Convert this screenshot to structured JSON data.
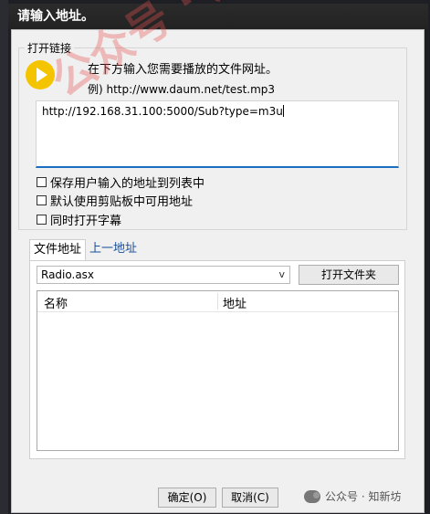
{
  "window": {
    "title": "请输入地址。"
  },
  "open_link": {
    "legend": "打开链接",
    "instruction": "在下方输入您需要播放的文件网址。",
    "example": "例) http://www.daum.net/test.mp3",
    "url_value": "http://192.168.31.100:5000/Sub?type=m3u"
  },
  "options": [
    {
      "label": "保存用户输入的地址到列表中",
      "checked": false
    },
    {
      "label": "默认使用剪贴板中可用地址",
      "checked": false
    },
    {
      "label": "同时打开字幕",
      "checked": false
    }
  ],
  "tabs": [
    {
      "label": "文件地址",
      "active": true
    },
    {
      "label": "上一地址",
      "active": false
    }
  ],
  "file_panel": {
    "combo_value": "Radio.asx",
    "combo_arrow": "v",
    "open_folder_label": "打开文件夹",
    "columns": [
      "名称",
      "地址"
    ]
  },
  "footer": {
    "ok_label": "确定(O)",
    "cancel_label": "取消(C)"
  },
  "watermark": {
    "text": "公众号 · 知新坊",
    "overlay_text": "公众号 · 知新坊"
  },
  "colors": {
    "titlebar": "#222222",
    "accent": "#1a6fc0",
    "play_icon": "#f5c400",
    "watermark": "#e65050"
  }
}
